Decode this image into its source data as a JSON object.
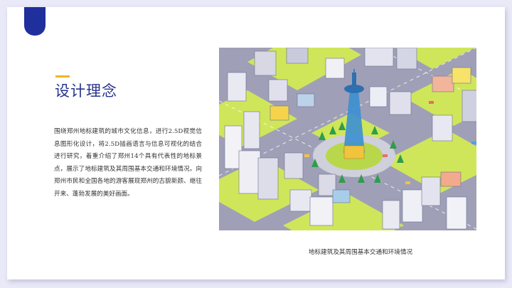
{
  "slide": {
    "title": "设计理念",
    "body": "围绕郑州地标建筑的城市文化信息，进行2.5D视觉信息图形化设计，将2.5D插画语言与信息可视化的结合进行研究，着重介绍了郑州14个具有代表性的地标景点，展示了地标建筑及其周围基本交通和环境情况。向郑州市民和全国各地的游客展现郑州的古貌新颜、继往开来、蓬勃发展的美好画面。",
    "image_caption": "地标建筑及其周围基本交通和环境情况"
  },
  "colors": {
    "accent_navy": "#1f2f9c",
    "title_blue": "#27348b",
    "accent_yellow": "#f0b429",
    "road_gray": "#9fa0b7",
    "grass_green": "#cfe65a"
  },
  "illustration": {
    "subject": "isometric city map with central landmark tower"
  }
}
